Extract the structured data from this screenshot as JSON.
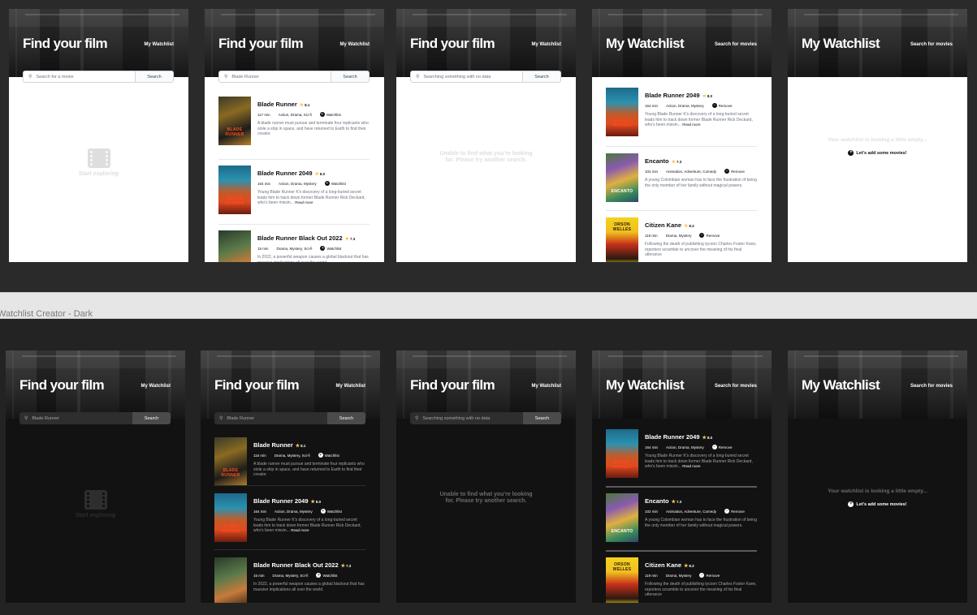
{
  "section_label": "Watchlist Creator - Dark",
  "find": {
    "title": "Find your film",
    "nav_link": "My Watchlist",
    "search_button": "Search",
    "placeholder": "Search for a movie",
    "query_blade_runner": "Blade Runner",
    "query_no_data": "Searching something with no data",
    "empty_label": "Start exploring",
    "no_results": [
      "Unable to find what you're looking",
      "for. Please try another search."
    ]
  },
  "watchlist": {
    "title": "My Watchlist",
    "nav_link": "Search for movies",
    "empty_message": "Your watchlist is looking a little empty...",
    "add_label": "Let's add some movies!"
  },
  "actions": {
    "add": "Watchlist",
    "remove": "Remove",
    "read_more": "Read more",
    "plus_icon": "+",
    "minus_icon": "−",
    "star_icon": "★",
    "search_icon": "⚲"
  },
  "movies": {
    "br": {
      "title": "Blade Runner",
      "rating": "8.1",
      "runtime_light": "117 min",
      "runtime_dark": "116 min",
      "genres_light": "Action, Drama, Sci-fi",
      "genres_dark": "Drama, Mystery, Sci-fi",
      "plot": "A blade runner must pursue and terminate four replicants who stole a ship in space, and have returned to Earth to find their creator.",
      "poster_text": "BLADE RUNNER"
    },
    "br2049": {
      "title": "Blade Runner 2049",
      "rating": "8.0",
      "runtime": "164 min",
      "genres": "Action, Drama, Mystery",
      "plot": "Young Blade Runner K's discovery of a long-buried secret leads him to track down former Blade Runner Rick Deckard, who's been missin...",
      "poster_text": "BLADE RUNNER"
    },
    "blackout": {
      "title": "Blade Runner Black Out 2022",
      "rating": "7.3",
      "runtime": "15 min",
      "genres": "Drama, Mystery, Sci-fi",
      "plot": "In 2022, a powerful weapon causes a global blackout that has massive implications all over the world."
    },
    "encanto": {
      "title": "Encanto",
      "rating": "7.3",
      "runtime": "102 min",
      "genres": "Animation, Adventure, Comedy",
      "plot": "A young Colombian woman has to face the frustration of being the only member of her family without magical powers.",
      "poster_text": "ENCANTO"
    },
    "kane": {
      "title": "Citizen Kane",
      "rating": "8.3",
      "runtime": "119 min",
      "genres": "Drama, Mystery",
      "plot": "Following the death of publishing tycoon Charles Foster Kane, reporters scramble to uncover the meaning of his final utterance",
      "poster_text": "ORSON WELLES"
    }
  },
  "colors": {
    "light_bg": "#ffffff",
    "dark_bg": "#121212",
    "star": "#fec654",
    "canvas": "#1e1e1e"
  }
}
